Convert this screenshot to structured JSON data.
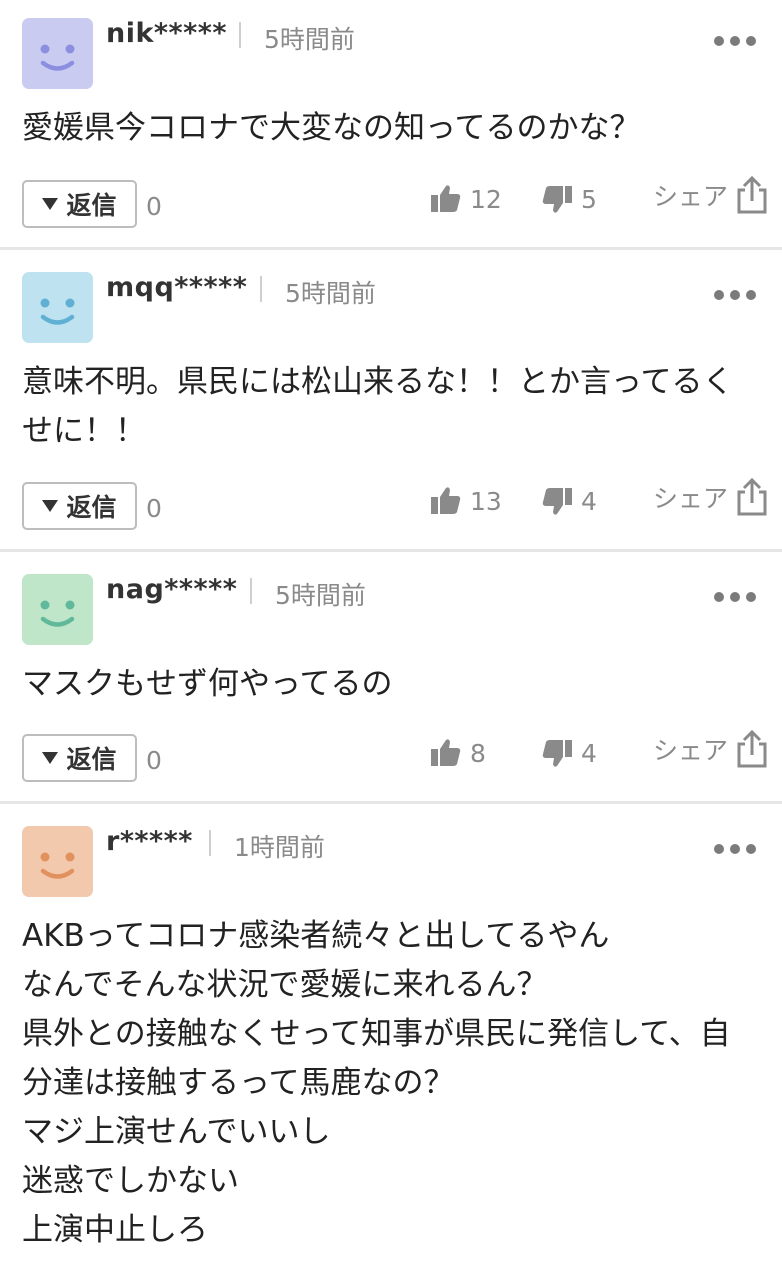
{
  "comments": [
    {
      "username": "nik*****",
      "time": "5時間前",
      "avatar_color": "#c9cbf1",
      "face_color": "#8c8fe0",
      "lines": [
        "愛媛県今コロナで大変なの知ってるのかな？"
      ],
      "reply_label": "返信",
      "reply_count": "0",
      "likes": "12",
      "dislikes": "5",
      "share_label": "シェア"
    },
    {
      "username": "mqq*****",
      "time": "5時間前",
      "avatar_color": "#bfe2f0",
      "face_color": "#5fb0d3",
      "lines": [
        "意味不明。県民には松山来るな！！とか言ってるく",
        "せに！！"
      ],
      "reply_label": "返信",
      "reply_count": "0",
      "likes": "13",
      "dislikes": "4",
      "share_label": "シェア"
    },
    {
      "username": "nag*****",
      "time": "5時間前",
      "avatar_color": "#bfe6c8",
      "face_color": "#5fb99a",
      "lines": [
        "マスクもせず何やってるの"
      ],
      "reply_label": "返信",
      "reply_count": "0",
      "likes": "8",
      "dislikes": "4",
      "share_label": "シェア"
    },
    {
      "username": "r*****",
      "time": "1時間前",
      "avatar_color": "#f2c9ad",
      "face_color": "#e0915d",
      "lines": [
        "AKBってコロナ感染者続々と出してるやん",
        "なんでそんな状況で愛媛に来れるん？",
        "県外との接触なくせって知事が県民に発信して、自",
        "分達は接触するって馬鹿なの？",
        "マジ上演せんでいいし",
        "迷惑でしかない",
        "上演中止しろ"
      ]
    }
  ]
}
